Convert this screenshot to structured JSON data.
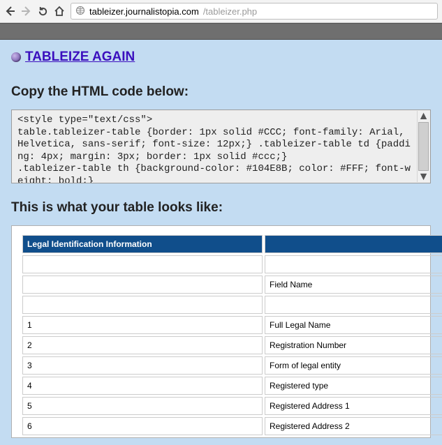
{
  "browser": {
    "url_host": "tableizer.journalistopia.com",
    "url_path": "/tableizer.php"
  },
  "page": {
    "again_link": "TABLEIZE AGAIN",
    "copy_heading": "Copy the HTML code below:",
    "preview_heading": "This is what your table looks like:",
    "code_output": "<style type=\"text/css\">\ntable.tableizer-table {border: 1px solid #CCC; font-family: Arial, Helvetica, sans-serif; font-size: 12px;} .tableizer-table td {padding: 4px; margin: 3px; border: 1px solid #ccc;}\n.tableizer-table th {background-color: #104E8B; color: #FFF; font-weight: bold;}\n</style>"
  },
  "table": {
    "header_col1": "Legal Identification Information",
    "header_col2": "",
    "rows": [
      {
        "c1": "",
        "c2": ""
      },
      {
        "c1": "",
        "c2": "Field Name"
      },
      {
        "c1": "",
        "c2": ""
      },
      {
        "c1": "1",
        "c2": "Full Legal Name"
      },
      {
        "c1": "2",
        "c2": "Registration Number"
      },
      {
        "c1": "3",
        "c2": "Form of legal entity"
      },
      {
        "c1": "4",
        "c2": "Registered type"
      },
      {
        "c1": "5",
        "c2": "Registered Address 1"
      },
      {
        "c1": "6",
        "c2": "Registered Address 2"
      }
    ]
  }
}
